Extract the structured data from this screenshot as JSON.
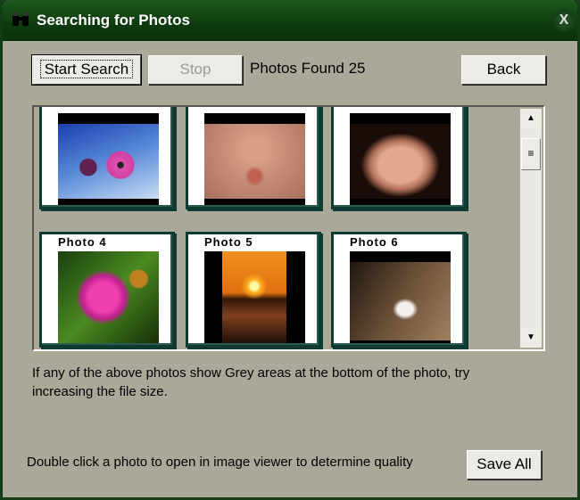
{
  "window": {
    "title": "Searching for Photos",
    "close": "X"
  },
  "toolbar": {
    "start_label": "Start Search",
    "stop_label": "Stop",
    "found_label": "Photos Found 25",
    "back_label": "Back"
  },
  "photos": [
    {
      "label": "",
      "subject": "pink daisies against blue sky"
    },
    {
      "label": "",
      "subject": "baby face close-up"
    },
    {
      "label": "",
      "subject": "baby portrait"
    },
    {
      "label": "Photo 4",
      "subject": "magenta flower with bee"
    },
    {
      "label": "Photo 5",
      "subject": "sunset over sea"
    },
    {
      "label": "Photo 6",
      "subject": "white rabbit"
    }
  ],
  "note": "If any of the above photos show Grey areas at the bottom of the photo, try increasing the file size.",
  "footer": {
    "hint": "Double click a photo to open in image viewer to determine quality",
    "save_all_label": "Save All"
  }
}
